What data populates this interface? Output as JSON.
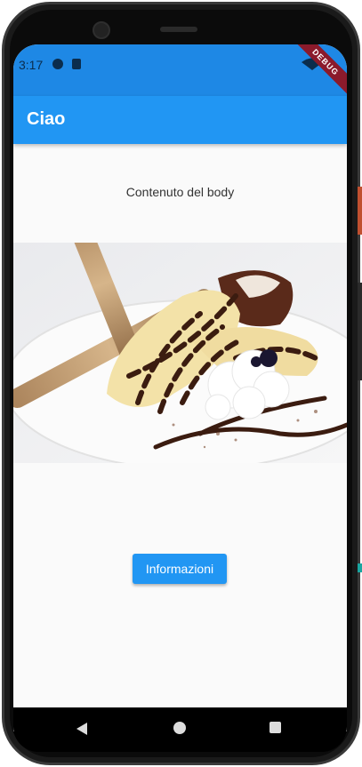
{
  "status_bar": {
    "time": "3:17",
    "debug_label": "DEBUG",
    "icons": [
      "app-notification-icon",
      "sim-card-icon",
      "wifi-icon",
      "battery-icon"
    ]
  },
  "app_bar": {
    "title": "Ciao"
  },
  "body": {
    "text": "Contenuto del body",
    "image_alt": "dessert-banana-chocolate-cream"
  },
  "button": {
    "label": "Informazioni"
  },
  "colors": {
    "status_bar": "#1e88e5",
    "app_bar": "#2196f3",
    "button": "#2196f3",
    "debug_ribbon": "#8b1a2b",
    "background": "#fafafa"
  },
  "nav_bar": {
    "icons": [
      "back-icon",
      "home-icon",
      "recent-apps-icon"
    ]
  }
}
